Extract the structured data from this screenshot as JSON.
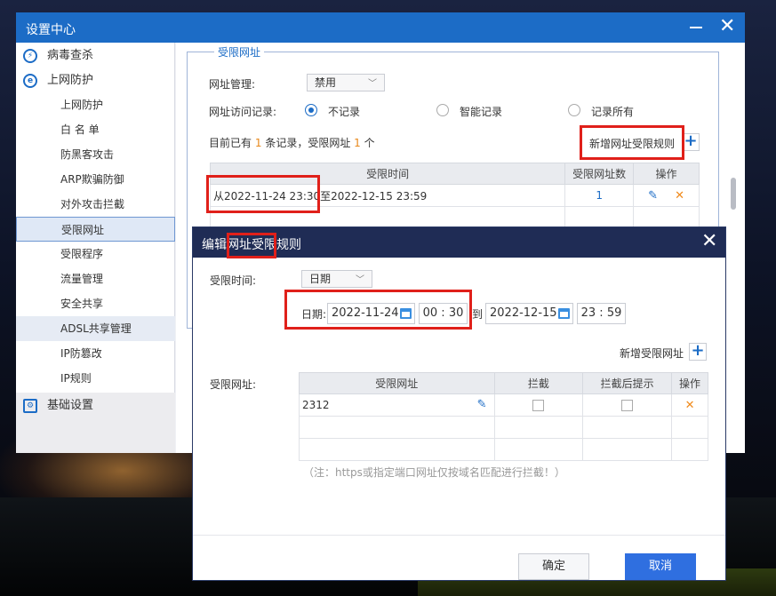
{
  "window": {
    "title": "设置中心"
  },
  "sidebar": {
    "groups": [
      {
        "label": "病毒查杀",
        "icon": "lightning-icon"
      },
      {
        "label": "上网防护",
        "icon": "globe-shield-icon"
      },
      {
        "label": "基础设置",
        "icon": "settings-doc-icon"
      }
    ],
    "items": [
      "上网防护",
      "白 名 单",
      "防黑客攻击",
      "ARP欺骗防御",
      "对外攻击拦截",
      "受限网址",
      "受限程序",
      "流量管理",
      "安全共享",
      "ADSL共享管理",
      "IP防篡改",
      "IP规则"
    ],
    "active": "受限网址"
  },
  "main": {
    "legend": "受限网址",
    "url_mgmt_label": "网址管理:",
    "url_mgmt_value": "禁用",
    "visit_record_label": "网址访问记录:",
    "radio_options": [
      "不记录",
      "智能记录",
      "记录所有"
    ],
    "radio_selected": "不记录",
    "summary_prefix": "目前已有",
    "summary_count1": "1",
    "summary_mid": "条记录，受限网址",
    "summary_count2": "1",
    "summary_suffix": "个",
    "add_rule_label": "新增网址受限规则",
    "table": {
      "headers": [
        "受限时间",
        "受限网址数",
        "操作"
      ],
      "rows": [
        {
          "time": "从2022-11-24 23:30至2022-12-15 23:59",
          "count": "1"
        }
      ]
    }
  },
  "dialog": {
    "title": "编辑网址受限规则",
    "time_label": "受限时间:",
    "time_type": "日期",
    "date_label": "日期:",
    "start_date": "2022-11-24",
    "start_hour": "00",
    "start_min": "30",
    "to_label": "到",
    "end_date": "2022-12-15",
    "end_hour": "23",
    "end_min": "59",
    "add_url_label": "新增受限网址",
    "urls_label": "受限网址:",
    "url_table": {
      "headers": [
        "受限网址",
        "拦截",
        "拦截后提示",
        "操作"
      ],
      "rows": [
        {
          "url": "2312",
          "block": false,
          "prompt": false
        }
      ]
    },
    "note": "（注：https或指定端口网址仅按域名匹配进行拦截！）",
    "ok_label": "确定",
    "cancel_label": "取消"
  },
  "colors": {
    "title_blue": "#1c6cc6",
    "dialog_title": "#1f2c55",
    "accent": "#2f6fe0",
    "orange": "#e8881a",
    "annotation_red": "#e0201a"
  }
}
